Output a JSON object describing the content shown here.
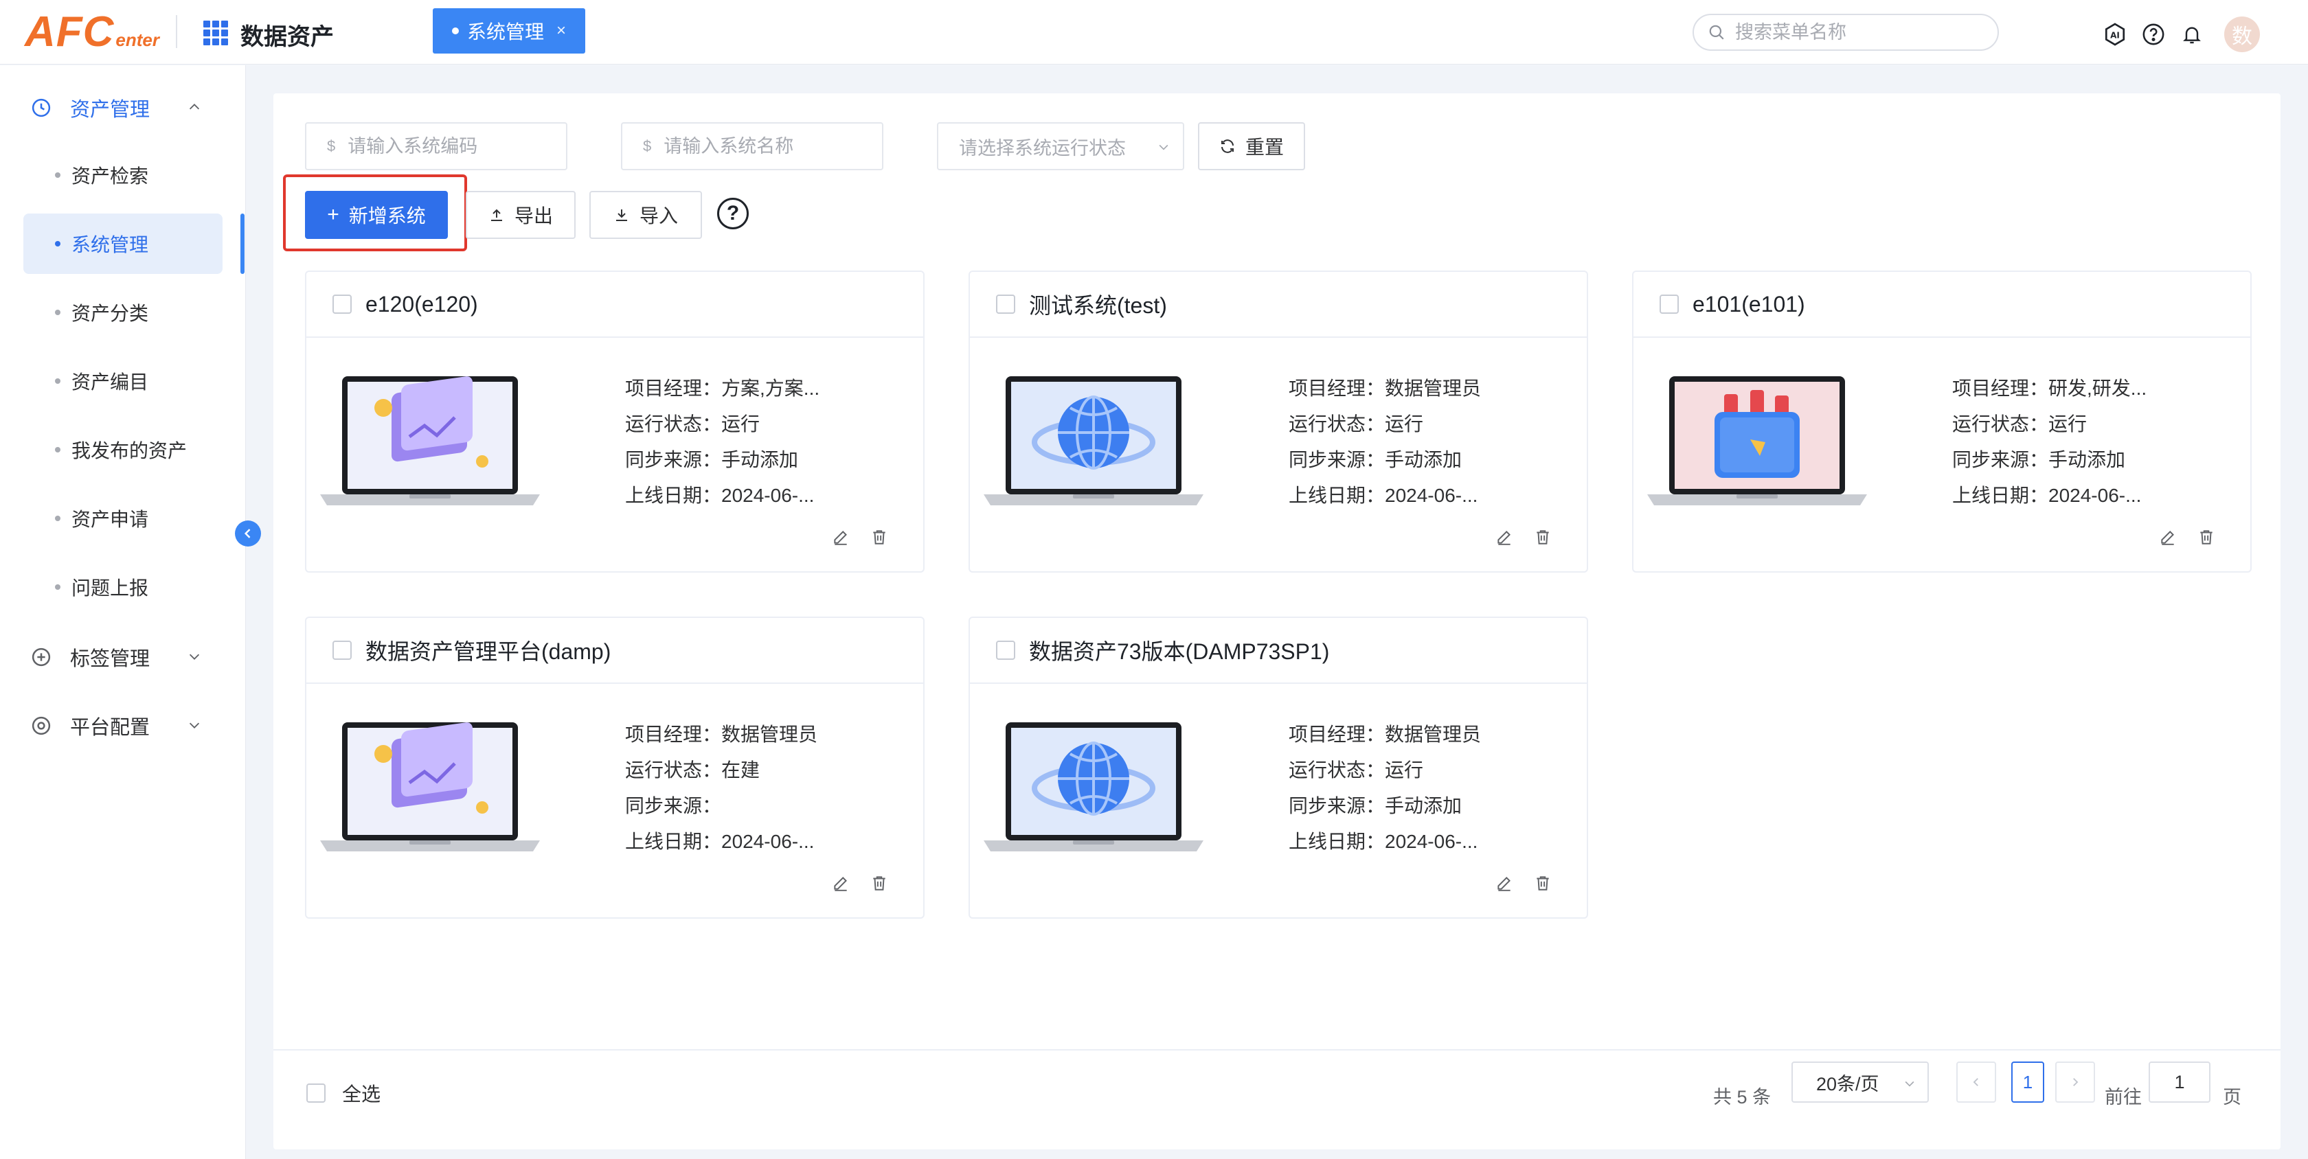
{
  "header": {
    "logo_big": "AFC",
    "logo_small": "enter",
    "app_title": "数据资产",
    "active_tab": "系统管理",
    "tab_close": "×",
    "search_placeholder": "搜索菜单名称",
    "avatar_text": "数"
  },
  "sidebar": {
    "group_asset": "资产管理",
    "items": [
      "资产检索",
      "系统管理",
      "资产分类",
      "资产编目",
      "我发布的资产",
      "资产申请",
      "问题上报"
    ],
    "group_tag": "标签管理",
    "group_platform": "平台配置"
  },
  "filters": {
    "code_placeholder": "请输入系统编码",
    "name_placeholder": "请输入系统名称",
    "status_placeholder": "请选择系统运行状态",
    "prefix": "$",
    "reset_label": "重置"
  },
  "toolbar": {
    "add_label": "新增系统",
    "export_label": "导出",
    "import_label": "导入",
    "help": "?"
  },
  "labels": {
    "manager": "项目经理：",
    "status": "运行状态：",
    "source": "同步来源：",
    "date": "上线日期："
  },
  "cards": [
    {
      "title": "e120(e120)",
      "manager": "方案,方案...",
      "status": "运行",
      "source": "手动添加",
      "date": "2024-06-...",
      "image": "chart-illustration"
    },
    {
      "title": "测试系统(test)",
      "manager": "数据管理员",
      "status": "运行",
      "source": "手动添加",
      "date": "2024-06-...",
      "image": "globe-illustration"
    },
    {
      "title": "e101(e101)",
      "manager": "研发,研发...",
      "status": "运行",
      "source": "手动添加",
      "date": "2024-06-...",
      "image": "wallet-illustration"
    },
    {
      "title": "数据资产管理平台(damp)",
      "manager": "数据管理员",
      "status": "在建",
      "source": "",
      "date": "2024-06-...",
      "image": "chart-illustration"
    },
    {
      "title": "数据资产73版本(DAMP73SP1)",
      "manager": "数据管理员",
      "status": "运行",
      "source": "手动添加",
      "date": "2024-06-...",
      "image": "globe-illustration"
    }
  ],
  "footer": {
    "select_all": "全选",
    "total": "共 5 条",
    "page_size": "20条/页",
    "current_page": "1",
    "goto_label": "前往",
    "goto_value": "1",
    "page_unit": "页"
  },
  "colors": {
    "primary": "#2f6fea",
    "logo": "#f0702a",
    "highlight": "#e0382d"
  }
}
